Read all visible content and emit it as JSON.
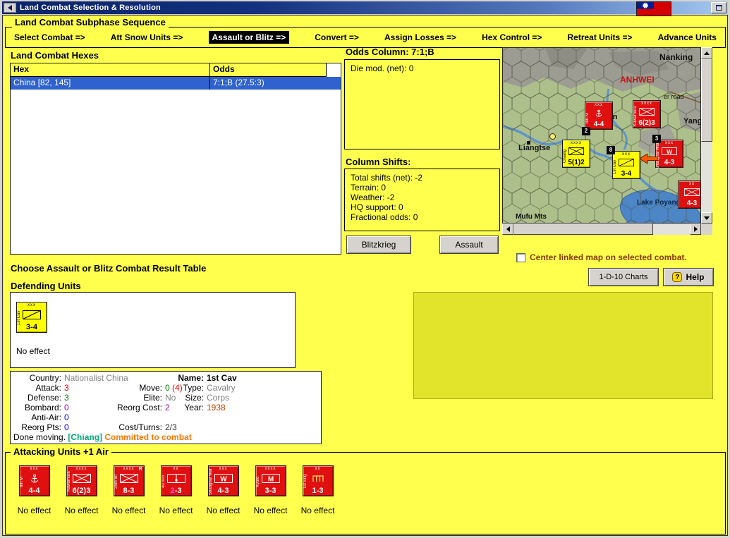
{
  "window": {
    "title": "Land Combat Selection & Resolution"
  },
  "sequence": {
    "title": "Land Combat Subphase Sequence",
    "steps": [
      {
        "label": "Select Combat =>"
      },
      {
        "label": "Att Snow Units =>"
      },
      {
        "label": "Assault or Blitz =>"
      },
      {
        "label": "Convert =>"
      },
      {
        "label": "Assign Losses =>"
      },
      {
        "label": "Hex Control =>"
      },
      {
        "label": "Retreat Units =>"
      },
      {
        "label": "Advance Units"
      }
    ],
    "active_step": "Assault or Blitz =>"
  },
  "hexes": {
    "title": "Land Combat Hexes",
    "columns": {
      "hex": "Hex",
      "odds": "Odds"
    },
    "rows": [
      {
        "hex": "China [82, 145]",
        "odds": "7:1;B (27.5:3)",
        "selected": true
      }
    ]
  },
  "odds_panel": {
    "title": "Odds Column: 7:1;B",
    "die_mod": "Die mod. (net): 0"
  },
  "shifts_panel": {
    "title": "Column Shifts:",
    "lines": [
      "Total shifts (net): -2",
      "Terrain: 0",
      "Weather: -2",
      "HQ support: 0",
      "Fractional odds: 0"
    ]
  },
  "actions": {
    "blitzkrieg": "Blitzkrieg",
    "assault": "Assault",
    "charts": "1-D-10 Charts",
    "help": "Help",
    "help_icon": "?"
  },
  "map": {
    "checkbox_label": "Center linked map on selected combat.",
    "labels": {
      "nanking": "Nanking",
      "anhwei": "ANHWEI",
      "road": "er road",
      "yangtze": "Yangt",
      "wuhan": "Wuhan",
      "liangtse": "Liangtse",
      "lake": "Lake Poyang",
      "mufu": "Mufu Mts"
    },
    "units": [
      {
        "name": "8th M",
        "size": "xxx",
        "value": "4-4"
      },
      {
        "name": "Kawamura",
        "size": "xxxx",
        "value": "6(2)3"
      },
      {
        "name": "Chiang",
        "size": "xxxx",
        "value": "5(1)2"
      },
      {
        "name": "1st Cav",
        "size": "xxx",
        "value": "3-4"
      },
      {
        "name": "Shanghai War",
        "size": "xxx",
        "value": "4-3"
      },
      {
        "name": "",
        "size": "xx",
        "value": "4-3"
      }
    ],
    "badges": [
      "2",
      "8",
      "3"
    ]
  },
  "choose_label": "Choose Assault or Blitz Combat Result Table",
  "defending": {
    "title": "Defending Units",
    "units": [
      {
        "name": "1st Cav",
        "size": "xxx",
        "value": "3-4",
        "status": "No effect"
      }
    ]
  },
  "unit_info": {
    "country_label": "Country:",
    "country": "Nationalist China",
    "name_label": "Name:",
    "name": "1st Cav",
    "attack_label": "Attack:",
    "attack": "3",
    "move_label": "Move:",
    "move": "0",
    "move_extra": "(4)",
    "type_label": "Type:",
    "type": "Cavalry",
    "defense_label": "Defense:",
    "defense": "3",
    "elite_label": "Elite:",
    "elite": "No",
    "size_label": "Size:",
    "size": "Corps",
    "bombard_label": "Bombard:",
    "bombard": "0",
    "reorg_cost_label": "Reorg Cost:",
    "reorg_cost": "2",
    "year_label": "Year:",
    "year": "1938",
    "anti_air_label": "Anti-Air:",
    "anti_air": "0",
    "reorg_pts_label": "Reorg Pts:",
    "reorg_pts": "0",
    "cost_turns_label": "Cost/Turns:",
    "cost_turns": "2/3",
    "status_done": "Done moving.",
    "status_hq": "[Chiang]",
    "status_committed": "Committed to combat"
  },
  "attacking": {
    "title": "Attacking Units +1 Air",
    "units": [
      {
        "name": "8th M",
        "size": "xxx",
        "value": "4-4",
        "status": "No effect"
      },
      {
        "name": "Kawamura",
        "size": "xxxx",
        "value": "6(2)3",
        "status": "No effect"
      },
      {
        "name": "25th Inf",
        "size": "xxxx",
        "value": "8-3",
        "status": "No effect",
        "badge": "R"
      },
      {
        "name": "40 mm",
        "size": "xx",
        "value_a": "2",
        "value_b": "-3",
        "status": "No effect"
      },
      {
        "name": "Shanghai War",
        "size": "xxx",
        "value": "4-3",
        "status": "No effect"
      },
      {
        "name": "Kyoto",
        "size": "xxxx",
        "value": "3-3",
        "status": "No effect"
      },
      {
        "name": "1st Eng",
        "size": "xx",
        "value": "1-3",
        "status": "No effect"
      }
    ]
  },
  "colors": {
    "background": "#ffff4d",
    "counter_red": "#e01010",
    "counter_yellow": "#ffff00",
    "selected_row_blue": "#2f62cf",
    "result_panel_yellow_green": "#e1e42b",
    "titlebar_blue": "#0a246a"
  }
}
